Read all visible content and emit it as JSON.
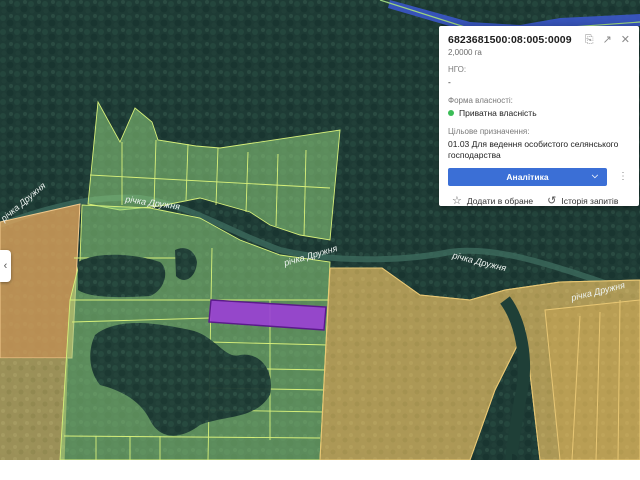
{
  "map": {
    "river_labels": [
      "річка Дружня",
      "річка Дружня",
      "річка Дружня",
      "річка Дружня",
      "річка Дружня"
    ],
    "colors": {
      "forest": "#1f3f37",
      "state_parcel": "#8fd07c",
      "other_parcel": "#e0a55c",
      "field": "#b9a560",
      "selected_parcel": "#9b3fd6",
      "river_blue": "#3a56c8"
    }
  },
  "card": {
    "cadastral_number": "6823681500:08:005:0009",
    "area": "2,0000 га",
    "ngo_label": "НГО:",
    "ngo_value": "-",
    "ownership_label": "Форма власності:",
    "ownership_value": "Приватна власність",
    "purpose_label": "Цільове призначення:",
    "purpose_value": "01.03 Для ведення особистого селянського господарства",
    "analytics_label": "Аналітика",
    "favorite_label": "Додати в обране",
    "history_label": "Історія запитів"
  },
  "icons": {
    "copy": "copy-icon",
    "open_external": "open-external-icon",
    "close": "close-icon",
    "chevron": "chevron-down-icon",
    "more": "more-vertical-icon",
    "star": "star-icon",
    "history": "history-icon",
    "collapse": "chevron-left-icon"
  }
}
